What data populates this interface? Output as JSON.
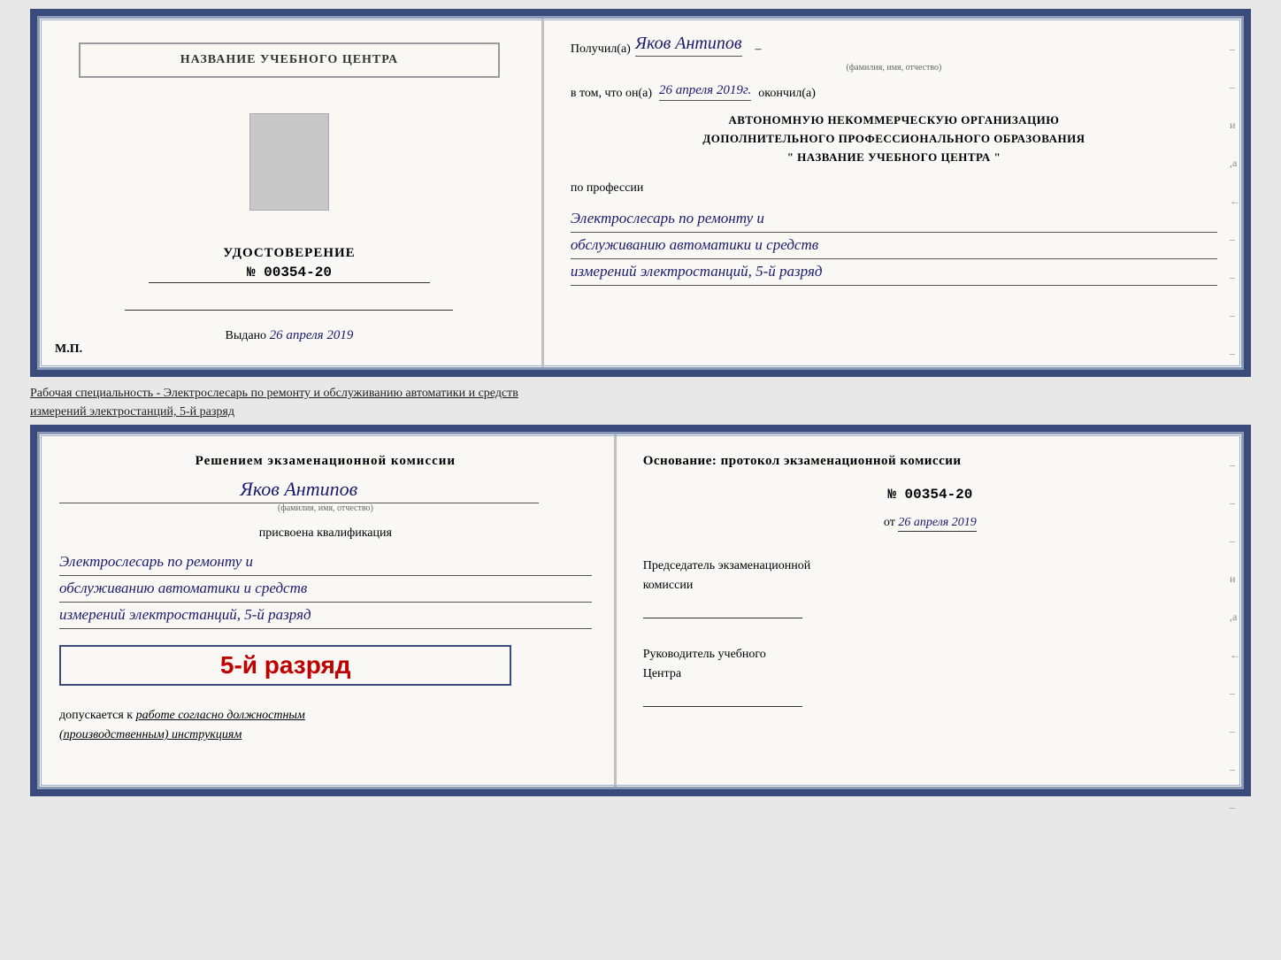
{
  "top_doc": {
    "left": {
      "title": "НАЗВАНИЕ УЧЕБНОГО ЦЕНТРА",
      "udost": "УДОСТОВЕРЕНИЕ",
      "number": "№ 00354-20",
      "vydano_label": "Выдано",
      "vydano_date": "26 апреля 2019",
      "mp": "М.П."
    },
    "right": {
      "poluchil": "Получил(а)",
      "name_handwritten": "Яков Антипов",
      "fio_label": "(фамилия, имя, отчество)",
      "vtom_label": "в том, что он(а)",
      "date_handwritten": "26 апреля 2019г.",
      "okonchil": "окончил(а)",
      "org_line1": "АВТОНОМНУЮ НЕКОММЕРЧЕСКУЮ ОРГАНИЗАЦИЮ",
      "org_line2": "ДОПОЛНИТЕЛЬНОГО ПРОФЕССИОНАЛЬНОГО ОБРАЗОВАНИЯ",
      "org_line3": "\"   НАЗВАНИЕ УЧЕБНОГО ЦЕНТРА   \"",
      "po_professii": "по профессии",
      "profession_line1": "Электрослесарь по ремонту и",
      "profession_line2": "обслуживанию автоматики и средств",
      "profession_line3": "измерений электростанций, 5-й разряд"
    }
  },
  "separator": {
    "text_line1": "Рабочая специальность - Электрослесарь по ремонту и обслуживанию автоматики и средств",
    "text_line2": "измерений электростанций, 5-й разряд"
  },
  "bottom_doc": {
    "left": {
      "resheniem": "Решением экзаменационной комиссии",
      "name_handwritten": "Яков Антипов",
      "fio_label": "(фамилия, имя, отчество)",
      "prisvoena": "присвоена квалификация",
      "profession_line1": "Электрослесарь по ремонту и",
      "profession_line2": "обслуживанию автоматики и средств",
      "profession_line3": "измерений электростанций, 5-й разряд",
      "razryad_badge": "5-й разряд",
      "dopuskaetsya": "допускается к",
      "dopusk_italic": "работе согласно должностным",
      "dopusk_italic2": "(производственным) инструкциям"
    },
    "right": {
      "osnovanie": "Основание: протокол экзаменационной комиссии",
      "protocol_number": "№ 00354-20",
      "ot_label": "от",
      "ot_date": "26 апреля 2019",
      "predsedatel_title": "Председатель экзаменационной",
      "predsedatel_subtitle": "комиссии",
      "rukovoditel_title": "Руководитель учебного",
      "rukovoditel_subtitle": "Центра"
    }
  }
}
